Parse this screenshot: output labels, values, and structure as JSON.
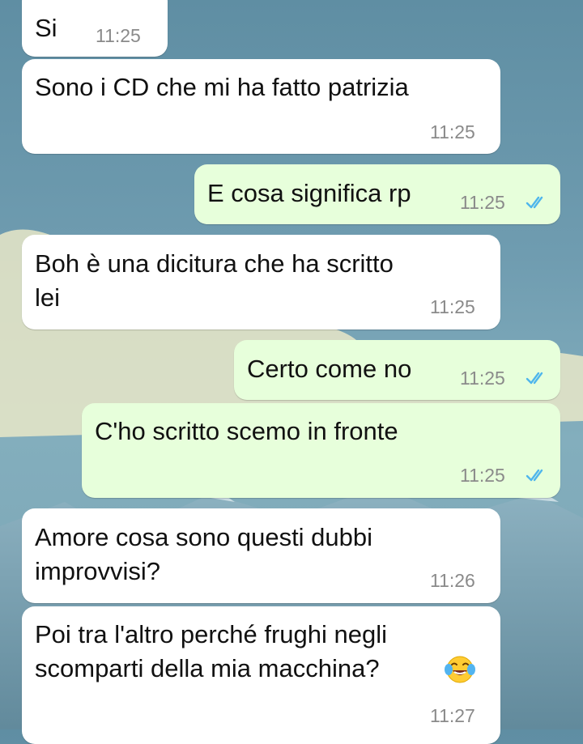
{
  "colors": {
    "incoming_bubble": "#ffffff",
    "outgoing_bubble": "#e7ffdb",
    "read_ticks": "#4fb6ec",
    "timestamp": "#8a8a8a"
  },
  "messages": [
    {
      "direction": "in",
      "lines": [
        "Si"
      ],
      "time": "11:25"
    },
    {
      "direction": "in",
      "lines": [
        "Sono i CD che mi ha fatto patrizia"
      ],
      "time": "11:25"
    },
    {
      "direction": "out",
      "lines": [
        "E cosa significa rp"
      ],
      "time": "11:25",
      "status_icon": "double-check-icon"
    },
    {
      "direction": "in",
      "lines": [
        "Boh è una dicitura che ha scritto",
        "lei"
      ],
      "time": "11:25"
    },
    {
      "direction": "out",
      "lines": [
        "Certo come no"
      ],
      "time": "11:25",
      "status_icon": "double-check-icon"
    },
    {
      "direction": "out",
      "lines": [
        "C'ho scritto scemo in fronte"
      ],
      "time": "11:25",
      "status_icon": "double-check-icon"
    },
    {
      "direction": "in",
      "lines": [
        "Amore cosa sono questi dubbi",
        "improvvisi?"
      ],
      "time": "11:26"
    },
    {
      "direction": "in",
      "lines": [
        "Poi tra l'altro perché frughi negli",
        "scomparti della mia macchina?"
      ],
      "time": "11:27",
      "emoji": "tears-of-joy-emoji"
    }
  ]
}
